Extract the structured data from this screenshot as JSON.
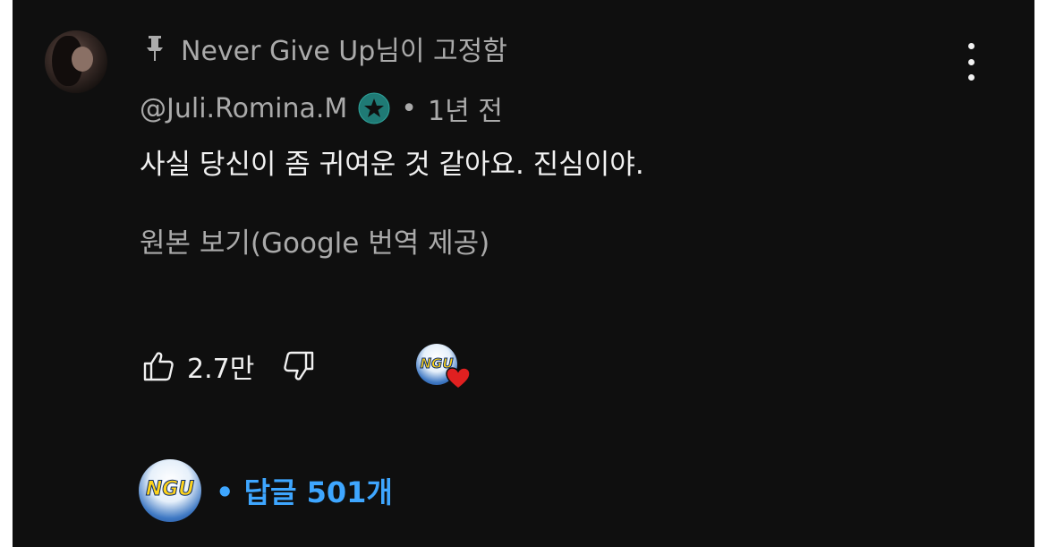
{
  "comment": {
    "pinned_by": "Never Give Up님이 고정함",
    "author_handle": "@Juli.Romina.M",
    "separator": "•",
    "time_ago": "1년 전",
    "text": "사실 당신이 좀 귀여운 것 같아요. 진심이야.",
    "translate_link": "원본 보기(Google 번역 제공)",
    "like_count": "2.7만",
    "creator_logo_text": "NGU",
    "replies_label": "• 답글 501개"
  },
  "colors": {
    "background": "#0f0f0f",
    "primary_text": "#f1f1f1",
    "secondary_text": "#aaaaaa",
    "link_blue": "#3ea6ff",
    "heart_red": "#e02020",
    "badge_teal": "#1f7a75"
  },
  "icons": {
    "pin": "pin-icon",
    "verified": "verified-star-icon",
    "more": "more-vert-icon",
    "like": "thumb-up-icon",
    "dislike": "thumb-down-icon",
    "heart": "heart-icon"
  }
}
